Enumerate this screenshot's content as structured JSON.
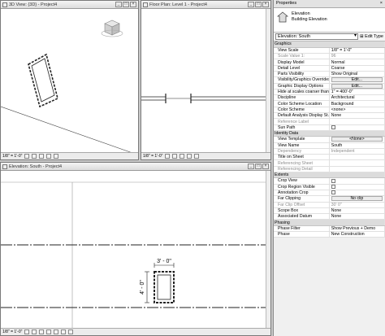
{
  "views": {
    "threed": {
      "title": "3D View: {3D} - Project4",
      "scale": "1/8\" = 1'-0\""
    },
    "floor": {
      "title": "Floor Plan: Level 1 - Project4",
      "scale": "1/8\" = 1'-0\""
    },
    "elevation": {
      "title": "Elevation: South - Project4",
      "scale": "1/8\" = 1'-0\"",
      "dim_width": "3' - 0\"",
      "dim_height": "4' - 0\""
    }
  },
  "properties": {
    "panel_title": "Properties",
    "type_name": "Elevation",
    "type_subname": "Building Elevation",
    "selector": "Elevation: South",
    "edit_type": "Edit Type",
    "rows": [
      {
        "g": "Graphics"
      },
      {
        "k": "View Scale",
        "v": "1/8\" = 1'-0\""
      },
      {
        "k": "Scale Value  1:",
        "v": "96",
        "dim": true
      },
      {
        "k": "Display Model",
        "v": "Normal"
      },
      {
        "k": "Detail Level",
        "v": "Coarse"
      },
      {
        "k": "Parts Visibility",
        "v": "Show Original"
      },
      {
        "k": "Visibility/Graphics Overrides",
        "v": "Edit...",
        "btn": true
      },
      {
        "k": "Graphic Display Options",
        "v": "Edit...",
        "btn": true
      },
      {
        "k": "Hide at scales coarser than",
        "v": "1\" = 400'-0\""
      },
      {
        "k": "Discipline",
        "v": "Architectural"
      },
      {
        "k": "Color Scheme Location",
        "v": "Background"
      },
      {
        "k": "Color Scheme",
        "v": "<none>"
      },
      {
        "k": "Default Analysis Display St...",
        "v": "None"
      },
      {
        "k": "Reference Label",
        "v": "",
        "dim": true
      },
      {
        "k": "Sun Path",
        "v": "",
        "cb": true
      },
      {
        "g": "Identity Data"
      },
      {
        "k": "View Template",
        "v": "<None>",
        "btn": true
      },
      {
        "k": "View Name",
        "v": "South"
      },
      {
        "k": "Dependency",
        "v": "Independent",
        "dim": true
      },
      {
        "k": "Title on Sheet",
        "v": ""
      },
      {
        "k": "Referencing Sheet",
        "v": "",
        "dim": true
      },
      {
        "k": "Referencing Detail",
        "v": "",
        "dim": true
      },
      {
        "g": "Extents"
      },
      {
        "k": "Crop View",
        "v": "",
        "cb": true
      },
      {
        "k": "Crop Region Visible",
        "v": "",
        "cb": true
      },
      {
        "k": "Annotation Crop",
        "v": "",
        "cb": true
      },
      {
        "k": "Far Clipping",
        "v": "No clip",
        "btn": true
      },
      {
        "k": "Far Clip Offset",
        "v": "30' 0\"",
        "dim": true
      },
      {
        "k": "Scope Box",
        "v": "None"
      },
      {
        "k": "Associated Datum",
        "v": "None"
      },
      {
        "g": "Phasing"
      },
      {
        "k": "Phase Filter",
        "v": "Show Previous + Demo"
      },
      {
        "k": "Phase",
        "v": "New Construction"
      }
    ]
  }
}
